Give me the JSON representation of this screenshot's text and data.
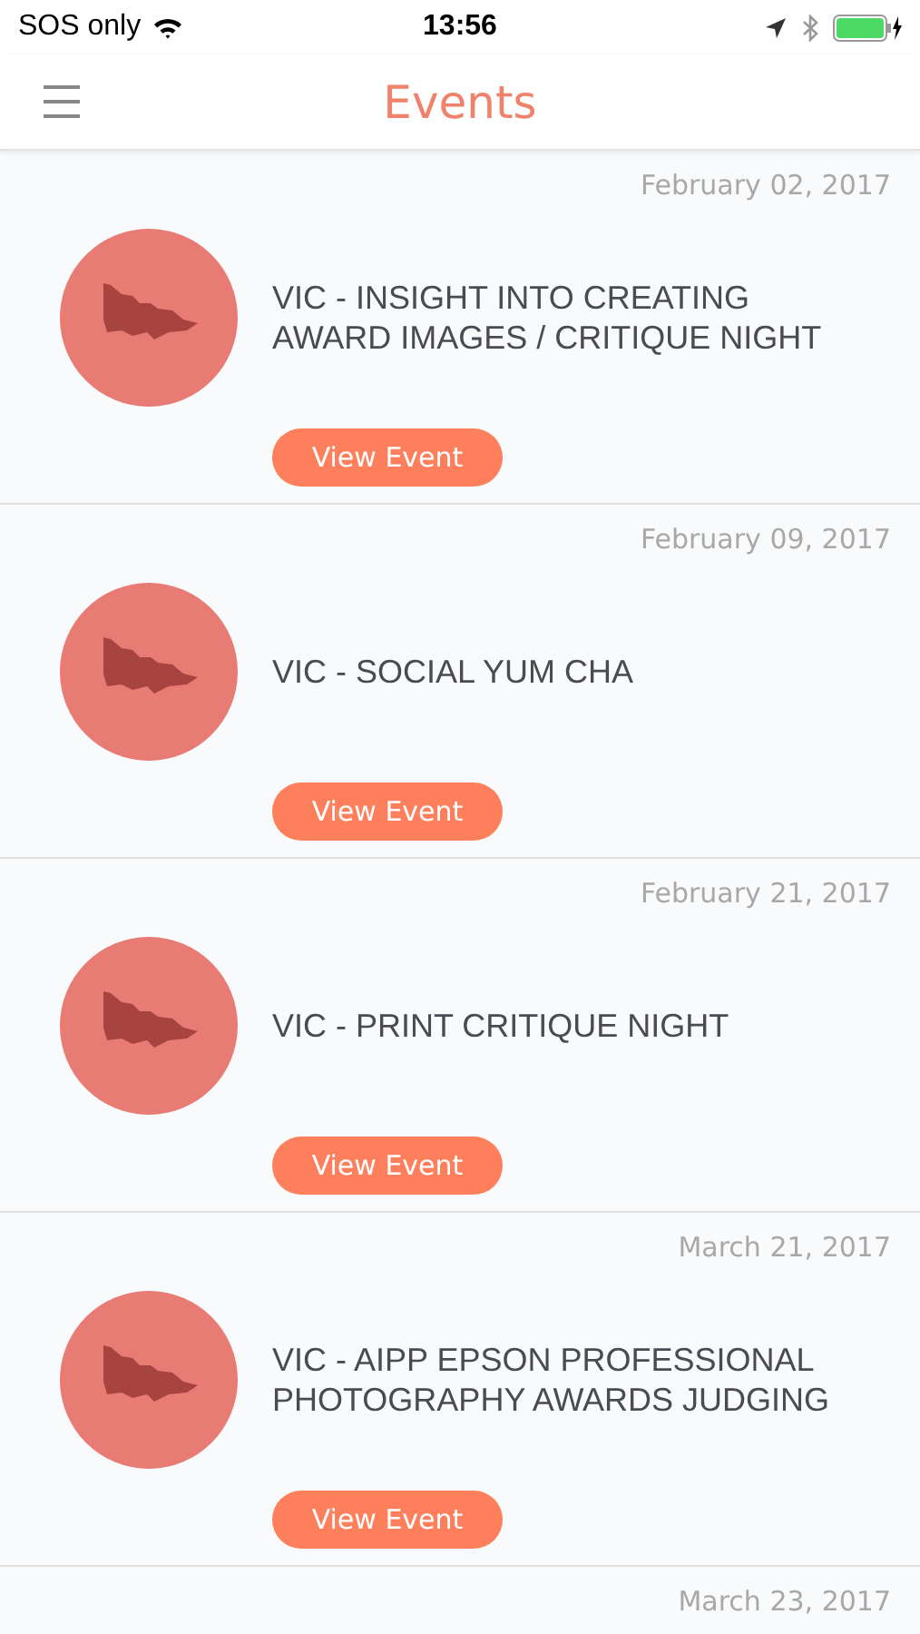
{
  "status_bar": {
    "carrier": "SOS only",
    "time": "13:56"
  },
  "nav": {
    "title": "Events"
  },
  "events": [
    {
      "date": "February 02, 2017",
      "title": "VIC - INSIGHT INTO CREATING AWARD IMAGES / CRITIQUE NIGHT",
      "button": "View Event"
    },
    {
      "date": "February 09, 2017",
      "title": "VIC - SOCIAL YUM CHA",
      "button": "View Event"
    },
    {
      "date": "February 21, 2017",
      "title": "VIC - PRINT CRITIQUE NIGHT",
      "button": "View Event"
    },
    {
      "date": "March 21, 2017",
      "title": "VIC - AIPP EPSON PROFESSIONAL PHOTOGRAPHY AWARDS JUDGING",
      "button": "View Event"
    },
    {
      "date": "March 23, 2017"
    }
  ]
}
